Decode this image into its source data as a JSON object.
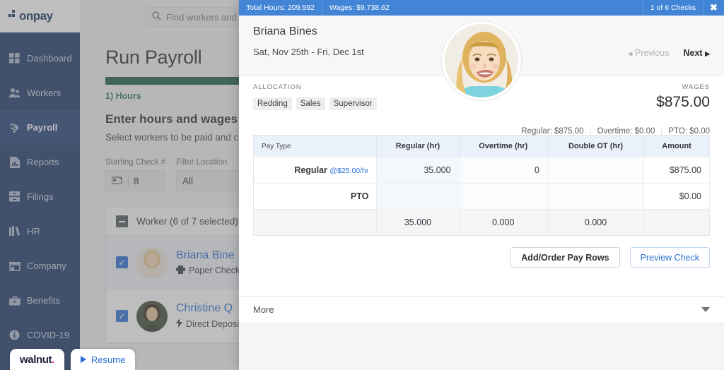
{
  "brand": {
    "logo": "onpay",
    "accent": "#2a6fd4",
    "sidebar_bg": "#1d3a6b",
    "modal_bar": "#4285d6",
    "progress_green": "#1c5f43"
  },
  "topbar": {
    "search_placeholder": "Find workers and co"
  },
  "sidebar": {
    "items": [
      {
        "label": "Dashboard",
        "icon": "grid-icon",
        "active": false
      },
      {
        "label": "Workers",
        "icon": "people-icon",
        "active": false
      },
      {
        "label": "Payroll",
        "icon": "hand-cash-icon",
        "active": true
      },
      {
        "label": "Reports",
        "icon": "report-icon",
        "active": false
      },
      {
        "label": "Filings",
        "icon": "drawer-icon",
        "active": false
      },
      {
        "label": "HR",
        "icon": "books-icon",
        "active": false
      },
      {
        "label": "Company",
        "icon": "store-icon",
        "active": false
      },
      {
        "label": "Benefits",
        "icon": "briefcase-icon",
        "active": false
      },
      {
        "label": "COVID-19",
        "icon": "info-icon",
        "active": false
      }
    ]
  },
  "main": {
    "title": "Run Payroll",
    "step_label": "1) Hours",
    "sub_heading": "Enter hours and wages",
    "sub_desc": "Select workers to be paid and click",
    "fields": [
      {
        "label": "Starting Check #",
        "value": "8",
        "icon": "check-icon"
      },
      {
        "label": "Filter Location",
        "value": "All"
      }
    ],
    "worker_list": {
      "header": "Worker (6 of 7 selected)",
      "rows": [
        {
          "name": "Briana Bine",
          "method": "Paper Check",
          "method_icon": "printer-icon",
          "checked": true,
          "selected": true
        },
        {
          "name": "Christine Q",
          "method": "Direct Deposi",
          "method_icon": "bolt-icon",
          "checked": true,
          "selected": false
        }
      ]
    }
  },
  "walnut": {
    "logo": "walnut.",
    "resume_label": "Resume",
    "play_icon": "play-icon"
  },
  "modal": {
    "summary": {
      "total_hours": "Total Hours: 209.592",
      "wages": "Wages: $9,738.62",
      "check_count": "1 of 6 Checks",
      "close_icon": "close-icon"
    },
    "employee_name": "Briana Bines",
    "pay_period": "Sat, Nov 25th - Fri, Dec 1st",
    "nav": {
      "previous": "Previous",
      "next": "Next"
    },
    "avatar_name": "briana-bines-avatar",
    "allocation": {
      "label": "ALLOCATION",
      "tags": [
        "Redding",
        "Sales",
        "Supervisor"
      ]
    },
    "wages": {
      "label": "WAGES",
      "amount": "$875.00",
      "breakdown": [
        "Regular: $875.00",
        "Overtime: $0.00",
        "PTO: $0.00"
      ]
    },
    "table": {
      "columns": [
        "Pay Type",
        "Regular (hr)",
        "Overtime (hr)",
        "Double OT (hr)",
        "Amount"
      ],
      "rows": [
        {
          "pay_type": "Regular",
          "rate": "@$25.00/hr",
          "regular": "35.000",
          "overtime": "0",
          "double_ot": "",
          "amount": "$875.00"
        },
        {
          "pay_type": "PTO",
          "rate": "",
          "regular": "",
          "overtime": "",
          "double_ot": "",
          "amount": "$0.00"
        }
      ],
      "totals": {
        "pay_type": "",
        "regular": "35.000",
        "overtime": "0.000",
        "double_ot": "0.000",
        "amount": ""
      }
    },
    "buttons": {
      "add_order": "Add/Order Pay Rows",
      "preview": "Preview Check"
    },
    "more": {
      "label": "More",
      "icon": "chevron-down-icon"
    }
  }
}
